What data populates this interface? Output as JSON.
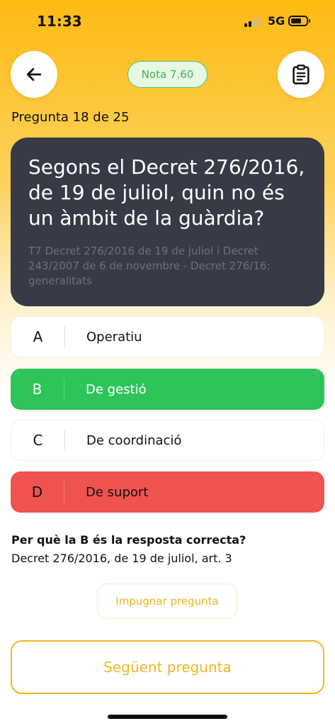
{
  "status_bar": {
    "time": "11:33",
    "network": "5G"
  },
  "header": {
    "back_icon": "arrow-left-icon",
    "grade_label": "Nota 7.60",
    "clipboard_icon": "clipboard-list-icon"
  },
  "question": {
    "counter": "Pregunta 18 de 25",
    "text": "Segons el Decret 276/2016, de 19 de juliol, quin no és un àmbit de la guàrdia?",
    "source": "T7 Decret 276/2016 de 19 de juliol i Decret 243/2007 de 6 de novembre - Decret 276/16: generalitats"
  },
  "answers": [
    {
      "letter": "A",
      "text": "Operatiu",
      "state": "neutral"
    },
    {
      "letter": "B",
      "text": "De gestió",
      "state": "correct"
    },
    {
      "letter": "C",
      "text": "De coordinació",
      "state": "neutral"
    },
    {
      "letter": "D",
      "text": "De suport",
      "state": "wrong"
    }
  ],
  "explanation": {
    "title": "Per què la B és la resposta correcta?",
    "reference": "Decret 276/2016, de 19 de juliol, art. 3"
  },
  "actions": {
    "impugn_label": "Impugnar pregunta",
    "next_label": "Següent pregunta"
  },
  "colors": {
    "accent": "#F2B623",
    "correct": "#2EC45B",
    "wrong": "#EF5350",
    "card": "#363B47"
  }
}
